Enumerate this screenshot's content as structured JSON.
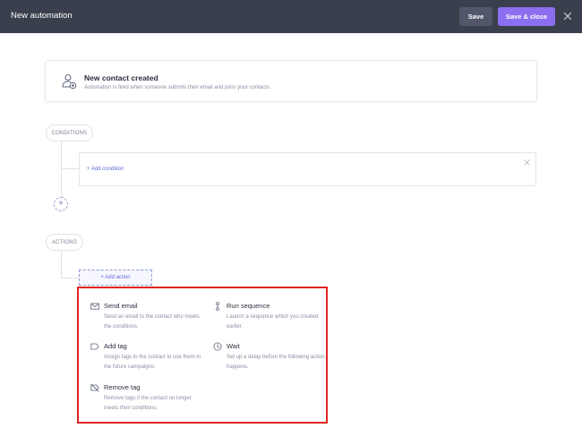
{
  "header": {
    "title": "New automation",
    "save_label": "Save",
    "save_close_label": "Save & close"
  },
  "trigger": {
    "title": "New contact created",
    "description": "Automation is fired when someone submits their email and joins your contacts."
  },
  "conditions": {
    "label": "CONDITIONS",
    "add_label": "+ Add condition"
  },
  "actions": {
    "label": "ACTIONS",
    "add_label": "+ Add action"
  },
  "action_menu": {
    "items": [
      {
        "name": "Send email",
        "description": "Send an email to the contact who meets the conditions.",
        "icon": "envelope-icon"
      },
      {
        "name": "Run sequence",
        "description": "Launch a sequence which you created earlier.",
        "icon": "sequence-icon"
      },
      {
        "name": "Add tag",
        "description": "Assign tags to the contact to use them in the future campaigns.",
        "icon": "tag-icon"
      },
      {
        "name": "Wait",
        "description": "Set up a delay before the following action happens.",
        "icon": "clock-icon"
      },
      {
        "name": "Remove tag",
        "description": "Remove tags if the contact no longer meets their conditions.",
        "icon": "tag-remove-icon"
      }
    ]
  },
  "colors": {
    "topbar": "#3a3f4d",
    "accent": "#8b6ff0",
    "link": "#5f6bd8",
    "highlight_border": "#e02424"
  }
}
